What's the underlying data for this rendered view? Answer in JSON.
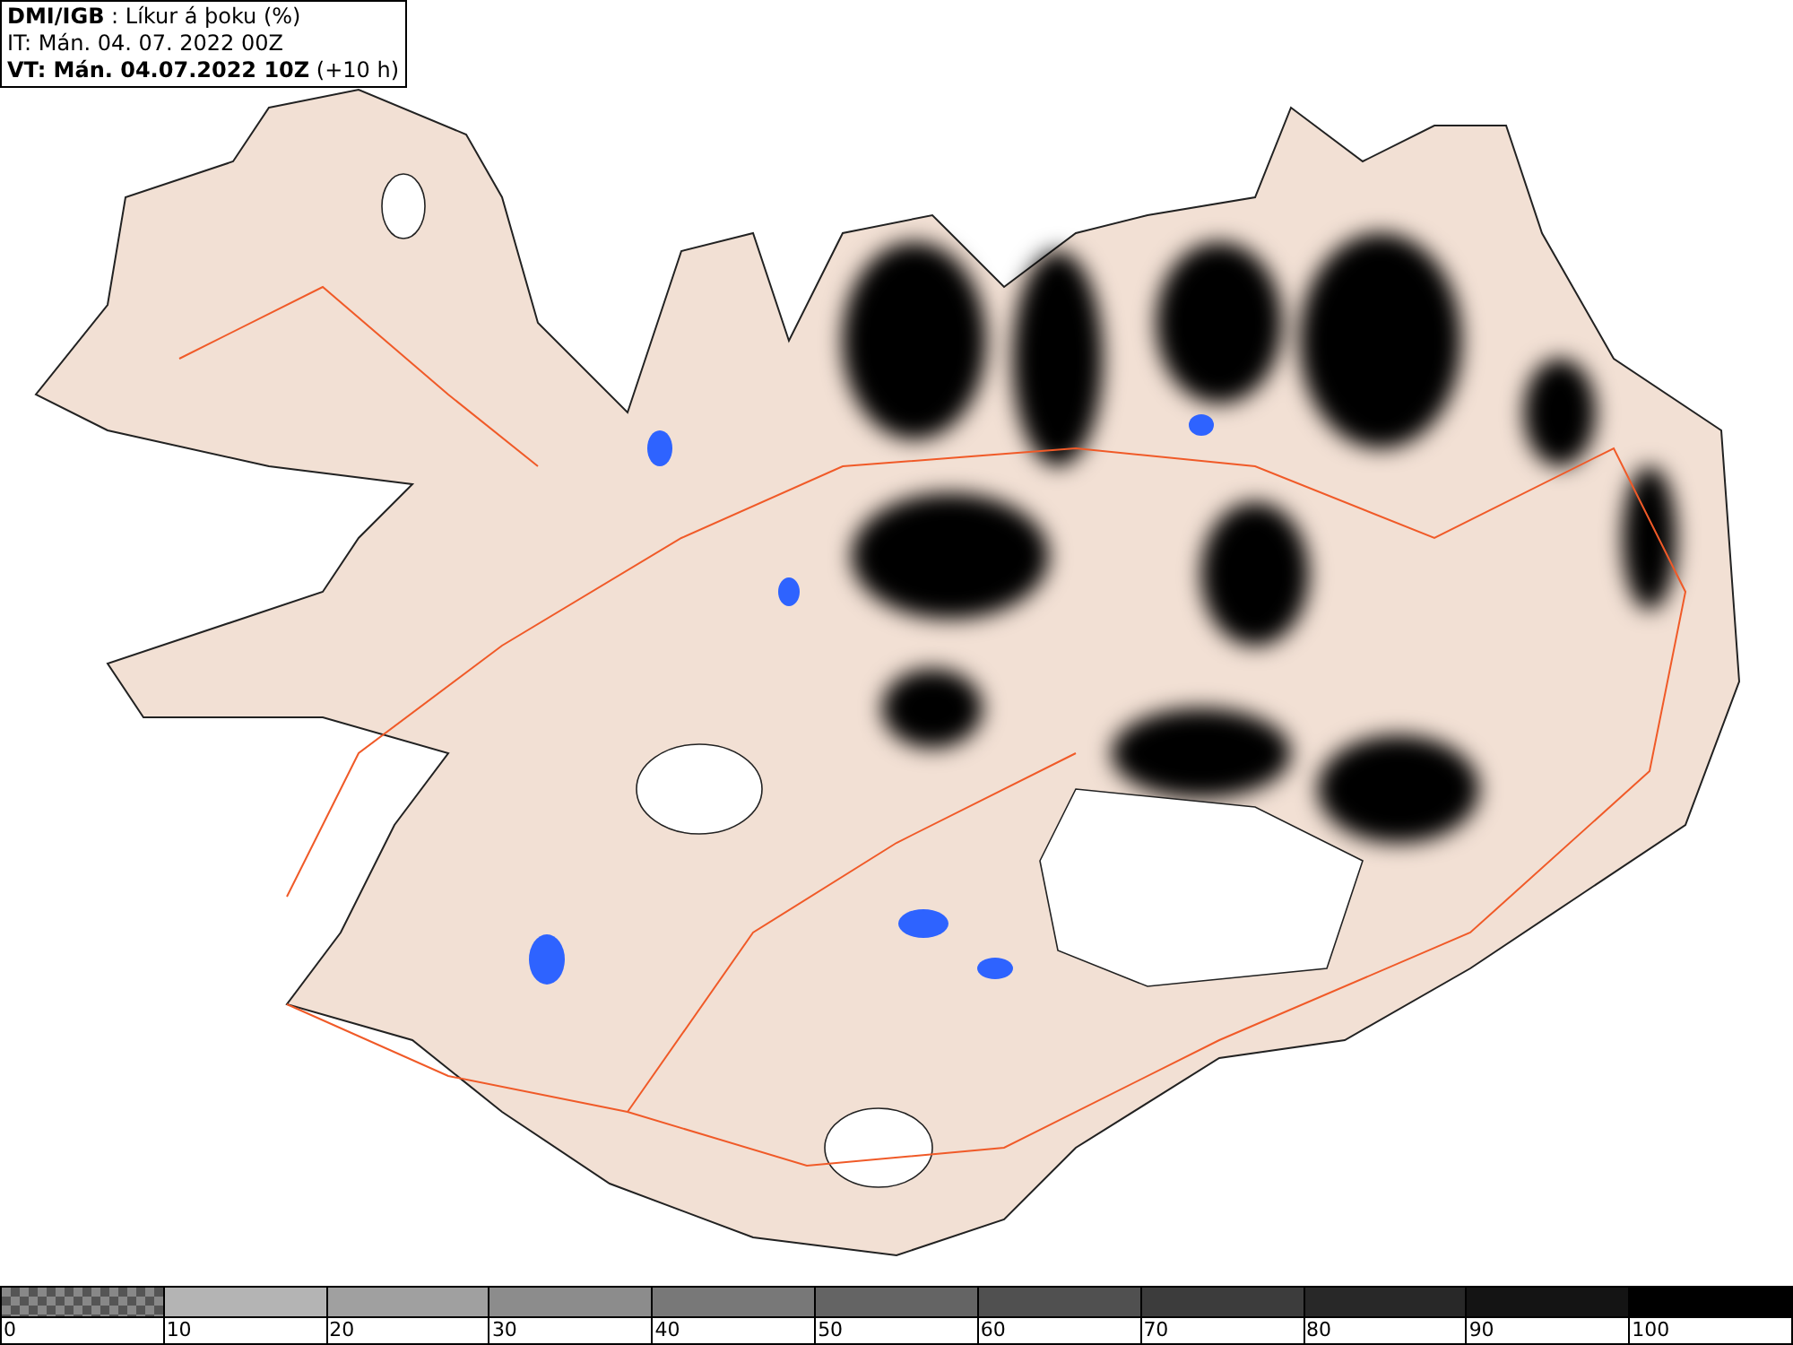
{
  "header": {
    "lines": [
      "**DMI/IGB** : Líkur á þoku (%)",
      "IT: Mán. 04. 07. 2022 00Z",
      "**VT: Mán. 04.07.2022 10Z** (+10 h)"
    ]
  },
  "legend": {
    "segments": [
      {
        "kind": "checker",
        "color": "#888888"
      },
      {
        "kind": "solid",
        "color": "#b4b4b4"
      },
      {
        "kind": "solid",
        "color": "#a0a0a0"
      },
      {
        "kind": "solid",
        "color": "#8c8c8c"
      },
      {
        "kind": "solid",
        "color": "#787878"
      },
      {
        "kind": "solid",
        "color": "#646464"
      },
      {
        "kind": "solid",
        "color": "#505050"
      },
      {
        "kind": "solid",
        "color": "#3c3c3c"
      },
      {
        "kind": "solid",
        "color": "#282828"
      },
      {
        "kind": "solid",
        "color": "#141414"
      },
      {
        "kind": "solid",
        "color": "#000000"
      }
    ],
    "labels": [
      "0",
      "10",
      "20",
      "30",
      "40",
      "50",
      "60",
      "70",
      "80",
      "90",
      "100"
    ]
  }
}
